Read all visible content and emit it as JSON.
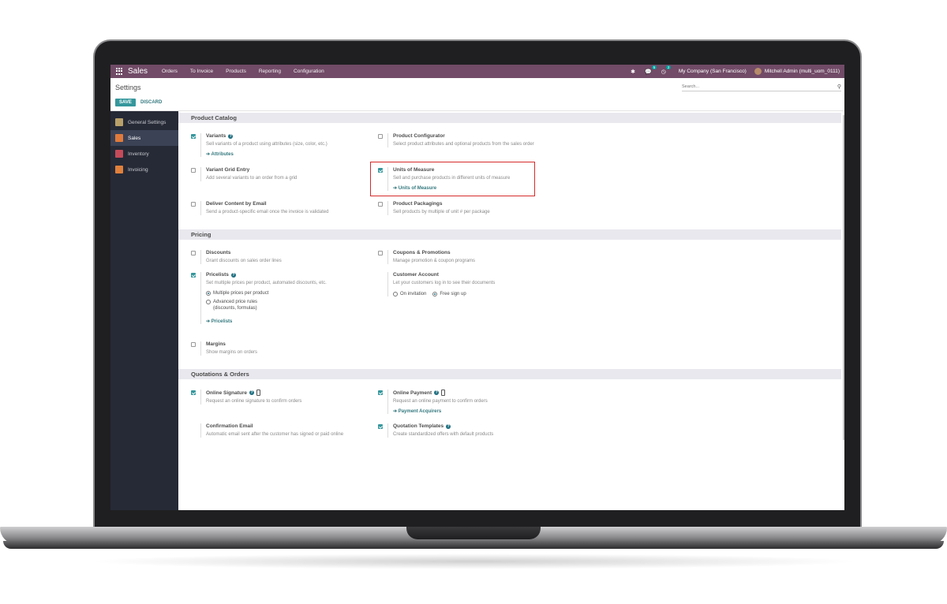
{
  "navbar": {
    "app_name": "Sales",
    "menu": [
      "Orders",
      "To Invoice",
      "Products",
      "Reporting",
      "Configuration"
    ],
    "messages_badge": "5",
    "activities_badge": "2",
    "company": "My Company (San Francisco)",
    "user": "Mitchell Admin (multi_uom_0111)",
    "accent_color": "#714b67"
  },
  "control": {
    "title": "Settings",
    "save_label": "SAVE",
    "discard_label": "DISCARD",
    "search_placeholder": "Search..."
  },
  "sidebar": {
    "items": [
      {
        "label": "General Settings",
        "icon": "gear-icon",
        "color": "#b9a06b"
      },
      {
        "label": "Sales",
        "icon": "sales-chart-icon",
        "color": "#e07a3c"
      },
      {
        "label": "Inventory",
        "icon": "inventory-box-icon",
        "color": "#c54a5a"
      },
      {
        "label": "Invoicing",
        "icon": "invoice-icon",
        "color": "#e0803c"
      }
    ],
    "active": "Sales"
  },
  "sections": {
    "product_catalog": "Product Catalog",
    "pricing": "Pricing",
    "quotations": "Quotations & Orders"
  },
  "settings": {
    "variants": {
      "title": "Variants",
      "desc": "Sell variants of a product using attributes (size, color, etc.)",
      "link": "Attributes",
      "checked": true
    },
    "product_configurator": {
      "title": "Product Configurator",
      "desc": "Select product attributes and optional products from the sales order",
      "checked": false
    },
    "variant_grid": {
      "title": "Variant Grid Entry",
      "desc": "Add several variants to an order from a grid",
      "checked": false
    },
    "uom": {
      "title": "Units of Measure",
      "desc": "Sell and purchase products in different units of measure",
      "link": "Units of Measure",
      "checked": true
    },
    "deliver_email": {
      "title": "Deliver Content by Email",
      "desc": "Send a product-specific email once the invoice is validated",
      "checked": false
    },
    "packagings": {
      "title": "Product Packagings",
      "desc": "Sell products by multiple of unit # per package",
      "checked": false
    },
    "discounts": {
      "title": "Discounts",
      "desc": "Grant discounts on sales order lines",
      "checked": false
    },
    "coupons": {
      "title": "Coupons & Promotions",
      "desc": "Manage promotion & coupon programs",
      "checked": false
    },
    "pricelists": {
      "title": "Pricelists",
      "desc": "Set multiple prices per product, automated discounts, etc.",
      "checked": true,
      "option1": "Multiple prices per product",
      "option2_line1": "Advanced price rules",
      "option2_line2": "(discounts, formulas)",
      "link": "Pricelists"
    },
    "customer_account": {
      "title": "Customer Account",
      "desc": "Let your customers log in to see their documents",
      "option1": "On invitation",
      "option2": "Free sign up"
    },
    "margins": {
      "title": "Margins",
      "desc": "Show margins on orders",
      "checked": false
    },
    "online_signature": {
      "title": "Online Signature",
      "desc": "Request an online signature to confirm orders",
      "checked": true
    },
    "online_payment": {
      "title": "Online Payment",
      "desc": "Request an online payment to confirm orders",
      "link": "Payment Acquirers",
      "checked": true
    },
    "confirmation_email": {
      "title": "Confirmation Email",
      "desc": "Automatic email sent after the customer has signed or paid online"
    },
    "quotation_templates": {
      "title": "Quotation Templates",
      "desc": "Create standardized offers with default products",
      "checked": true
    }
  },
  "link_arrow": "➔"
}
